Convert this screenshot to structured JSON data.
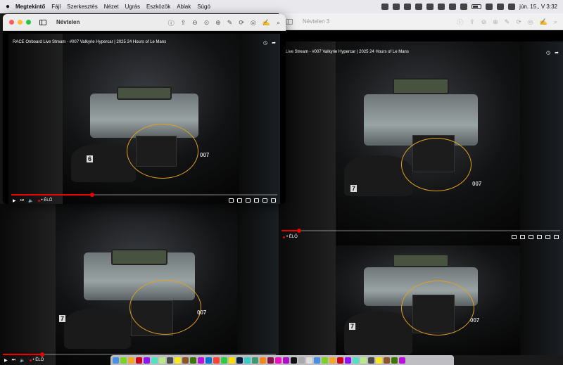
{
  "menubar": {
    "apple": "",
    "app_name": "Megtekintő",
    "items": [
      "Fájl",
      "Szerkesztés",
      "Nézet",
      "Ugrás",
      "Eszközök",
      "Ablak",
      "Súgó"
    ],
    "clock": "jún. 15., V 3:32"
  },
  "window_front": {
    "title": "Névtelen"
  },
  "window_back": {
    "title": "Névtelen 3"
  },
  "video": {
    "title_full": "RACE Onboard Live Stream - #007 Valkyrie Hypercar | 2025 24 Hours of Le Mans",
    "title_cropped": "Live Stream - #007 Valkyrie Hypercar | 2025 24 Hours of Le Mans",
    "live_label": "• ÉLŐ",
    "car_number": "007",
    "position_number_a": "6",
    "position_number_b": "7"
  },
  "colors": {
    "highlight_ring": "#e0a020",
    "progress": "#ee0000",
    "accent": "#28c840"
  },
  "dock_colors": [
    "#4a90e2",
    "#7ed321",
    "#f5a623",
    "#d0021b",
    "#9013fe",
    "#50e3c2",
    "#b8e986",
    "#4a4a4a",
    "#f8e71c",
    "#8b572a",
    "#417505",
    "#bd10e0",
    "#0074d9",
    "#ff4136",
    "#2ecc40",
    "#ffdc00",
    "#001f3f",
    "#39cccc",
    "#3d9970",
    "#ff851b",
    "#85144b",
    "#f012be",
    "#b10dc9",
    "#111111",
    "#aaaaaa",
    "#dddddd",
    "#4a90e2",
    "#7ed321",
    "#f5a623",
    "#d0021b",
    "#9013fe",
    "#50e3c2",
    "#b8e986",
    "#4a4a4a",
    "#f8e71c",
    "#8b572a",
    "#417505",
    "#bd10e0"
  ]
}
